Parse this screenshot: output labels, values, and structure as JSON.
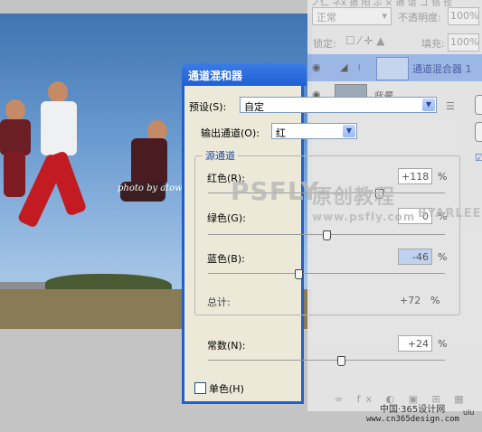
{
  "colors": {
    "title_bar": "#1f5fd4",
    "dialog_bg": "#ece9d8",
    "panel_bg": "#e6e6e6"
  },
  "layers_panel": {
    "tabs": "ノ仁 ネx 据 阳 ぶ  ×  通 诅 ゴ 铬 径",
    "blend_mode": "正常",
    "opacity_label": "不透明度:",
    "opacity_value": "100%",
    "lock_label": "锁定:",
    "fill_label": "填充:",
    "fill_value": "100%",
    "layer1_name": "通道混合器 1",
    "layer2_name": "背景"
  },
  "dialog": {
    "title": "通道混和器",
    "preset_label": "预设(S):",
    "preset_value": "自定",
    "output_label": "输出通道(O):",
    "output_value": "红",
    "group_label": "源通道",
    "red_label": "红色(R):",
    "red_value": "+118",
    "red_level": 0.72,
    "green_label": "绿色(G):",
    "green_value": "0",
    "green_level": 0.5,
    "blue_label": "蓝色(B):",
    "blue_value": "-46",
    "blue_level": 0.38,
    "percent": "%",
    "total_label": "总计:",
    "total_value": "+72",
    "constant_label": "常数(N):",
    "constant_value": "+24",
    "constant_level": 0.56,
    "mono_label": "单色(H)"
  },
  "photo": {
    "credit": "photo by atow"
  },
  "watermarks": {
    "brand_en": "PSFLY",
    "brand_cn": "原创教程",
    "url": "www.psfly.com",
    "by": "BYARLEE"
  },
  "footer": {
    "site": "中国·365设计网",
    "url": "www.cn365design.com",
    "corner": "uiu"
  }
}
